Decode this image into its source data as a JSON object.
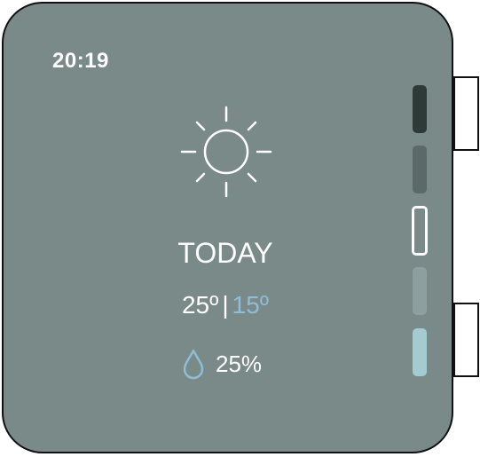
{
  "status": {
    "time": "20:19"
  },
  "weather": {
    "icon": "sun-icon",
    "day_label": "TODAY",
    "high": "25º",
    "separator": "|",
    "low": "15º",
    "precip_icon": "raindrop-icon",
    "precipitation": "25%"
  },
  "pager": {
    "pages": 5,
    "current_page": 3
  },
  "colors": {
    "screen_bg": "#7a8a89",
    "text": "#ffffff",
    "accent": "#8fbdd6",
    "pip_1": "#2e3a38",
    "pip_2": "#5b6968",
    "pip_4": "#8e9f9f",
    "pip_5": "#a3cbd1"
  }
}
